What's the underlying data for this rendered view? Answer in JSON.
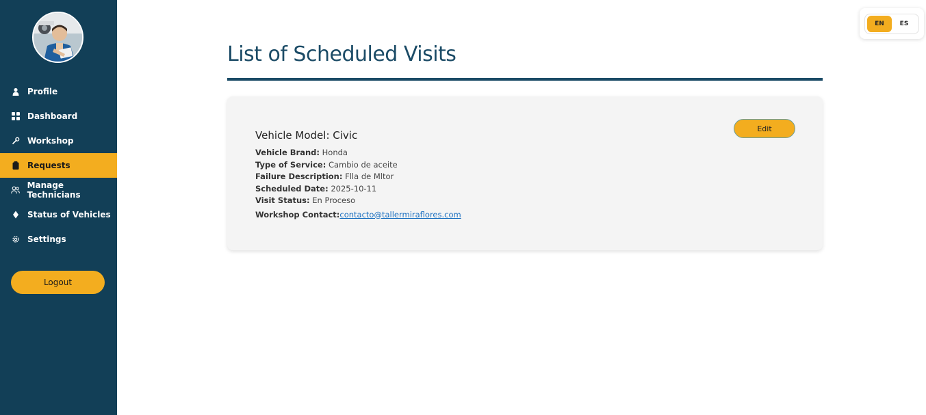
{
  "sidebar": {
    "items": [
      {
        "label": "Profile",
        "icon": "user-icon",
        "active": false
      },
      {
        "label": "Dashboard",
        "icon": "grid-icon",
        "active": false
      },
      {
        "label": "Workshop",
        "icon": "wrench-icon",
        "active": false
      },
      {
        "label": "Requests",
        "icon": "clipboard-icon",
        "active": true
      },
      {
        "label": "Manage Technicians",
        "icon": "users-icon",
        "active": false
      },
      {
        "label": "Status of Vehicles",
        "icon": "diamond-icon",
        "active": false
      },
      {
        "label": "Settings",
        "icon": "gear-icon",
        "active": false
      }
    ],
    "logout_label": "Logout"
  },
  "lang": {
    "en": "EN",
    "es": "ES",
    "active": "EN"
  },
  "main": {
    "title": "List of Scheduled Visits",
    "visits": [
      {
        "title": "Vehicle Model: Civic",
        "edit_label": "Edit",
        "fields": [
          {
            "label": "Vehicle Brand:",
            "value": "Honda"
          },
          {
            "label": "Type of Service:",
            "value": "Cambio de aceite"
          },
          {
            "label": "Failure Description:",
            "value": "Flla de Mltor"
          },
          {
            "label": "Scheduled Date:",
            "value": "2025-10-11"
          },
          {
            "label": "Visit Status:",
            "value": "En Proceso"
          }
        ],
        "contact_label": "Workshop Contact:",
        "contact_email": "contacto@tallermiraflores.com"
      }
    ]
  },
  "colors": {
    "sidebar": "#123f57",
    "accent": "#f3ad1f",
    "title": "#1b4b66",
    "link": "#1a6fc0"
  }
}
